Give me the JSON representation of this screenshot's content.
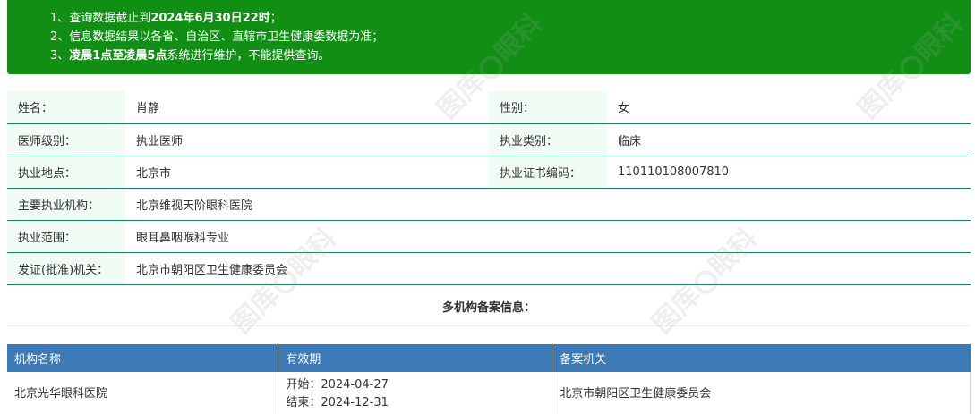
{
  "notice": {
    "line1_prefix": "1、查询数据截止到",
    "line1_bold": "2024年6月30日22时",
    "line1_suffix": "；",
    "line2": "2、信息数据结果以各省、自治区、直辖市卫生健康委数据为准；",
    "line3_prefix": "3、",
    "line3_bold": "凌晨1点至凌晨5点",
    "line3_suffix": "系统进行维护，不能提供查询。"
  },
  "info": {
    "name_label": "姓名：",
    "name_value": "肖静",
    "gender_label": "性别：",
    "gender_value": "女",
    "level_label": "医师级别：",
    "level_value": "执业医师",
    "category_label": "执业类别：",
    "category_value": "临床",
    "location_label": "执业地点：",
    "location_value": "北京市",
    "cert_label": "执业证书编码：",
    "cert_value": "110110108007810",
    "institution_label": "主要执业机构：",
    "institution_value": "北京维视天阶眼科医院",
    "scope_label": "执业范围：",
    "scope_value": "眼耳鼻咽喉科专业",
    "authority_label": "发证(批准)机关：",
    "authority_value": "北京市朝阳区卫生健康委员会"
  },
  "multi": {
    "title": "多机构备案信息：",
    "headers": [
      "机构名称",
      "有效期",
      "备案机关"
    ],
    "rows": [
      {
        "name": "北京光华眼科医院",
        "start": "开始：2024-04-27",
        "end": "结束：2024-12-31",
        "authority": "北京市朝阳区卫生健康委员会"
      }
    ]
  },
  "watermark": {
    "text_a": "图",
    "text_b": "库",
    "text_c": "眼科"
  },
  "colors": {
    "banner": "#118f15",
    "table_header": "#3c7ab8",
    "label_bg": "#f0fbf4",
    "row_border": "#1e7e70"
  }
}
